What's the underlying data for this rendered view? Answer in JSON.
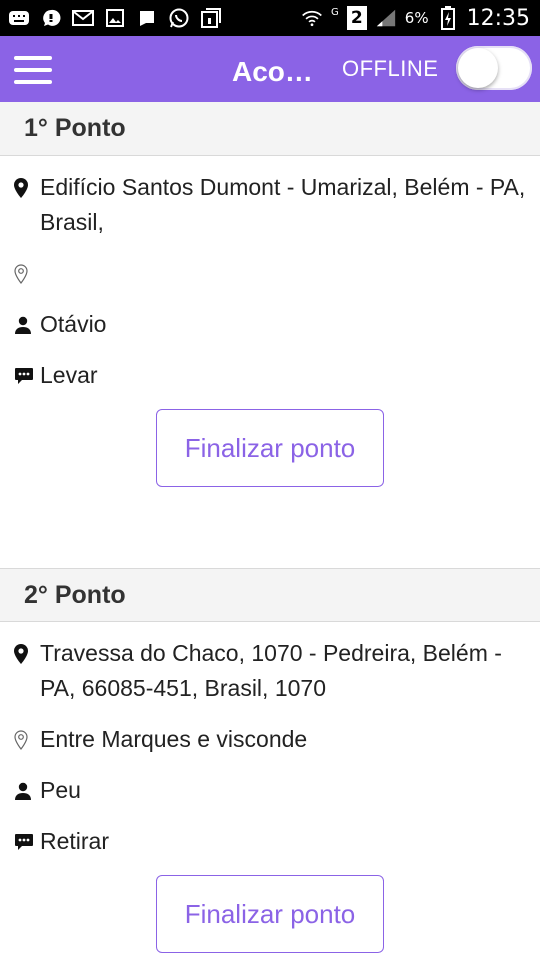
{
  "status_bar": {
    "battery_pct": "6%",
    "sim_badge": "2",
    "network_letter": "G",
    "time": "12:35",
    "icons": [
      "keyboard-icon",
      "chat-bubble-icon",
      "gmail-icon",
      "gallery-icon",
      "hangouts-icon",
      "whatsapp-icon",
      "screenshot-icon",
      "wifi-icon",
      "signal-icon",
      "battery-icon"
    ]
  },
  "appbar": {
    "title": "Aco…",
    "offline_label": "OFFLINE",
    "toggle_on": false,
    "color": "#8b63e6"
  },
  "points": [
    {
      "header": "1° Ponto",
      "address": "Edifício Santos Dumont - Umarizal, Belém - PA, Brasil,",
      "reference": "",
      "person": "Otávio",
      "action": "Levar",
      "button_label": "Finalizar ponto"
    },
    {
      "header": "2° Ponto",
      "address": "Travessa do Chaco, 1070 - Pedreira, Belém - PA, 66085-451, Brasil, 1070",
      "reference": "Entre Marques e visconde",
      "person": "Peu",
      "action": "Retirar",
      "button_label": "Finalizar ponto"
    }
  ]
}
